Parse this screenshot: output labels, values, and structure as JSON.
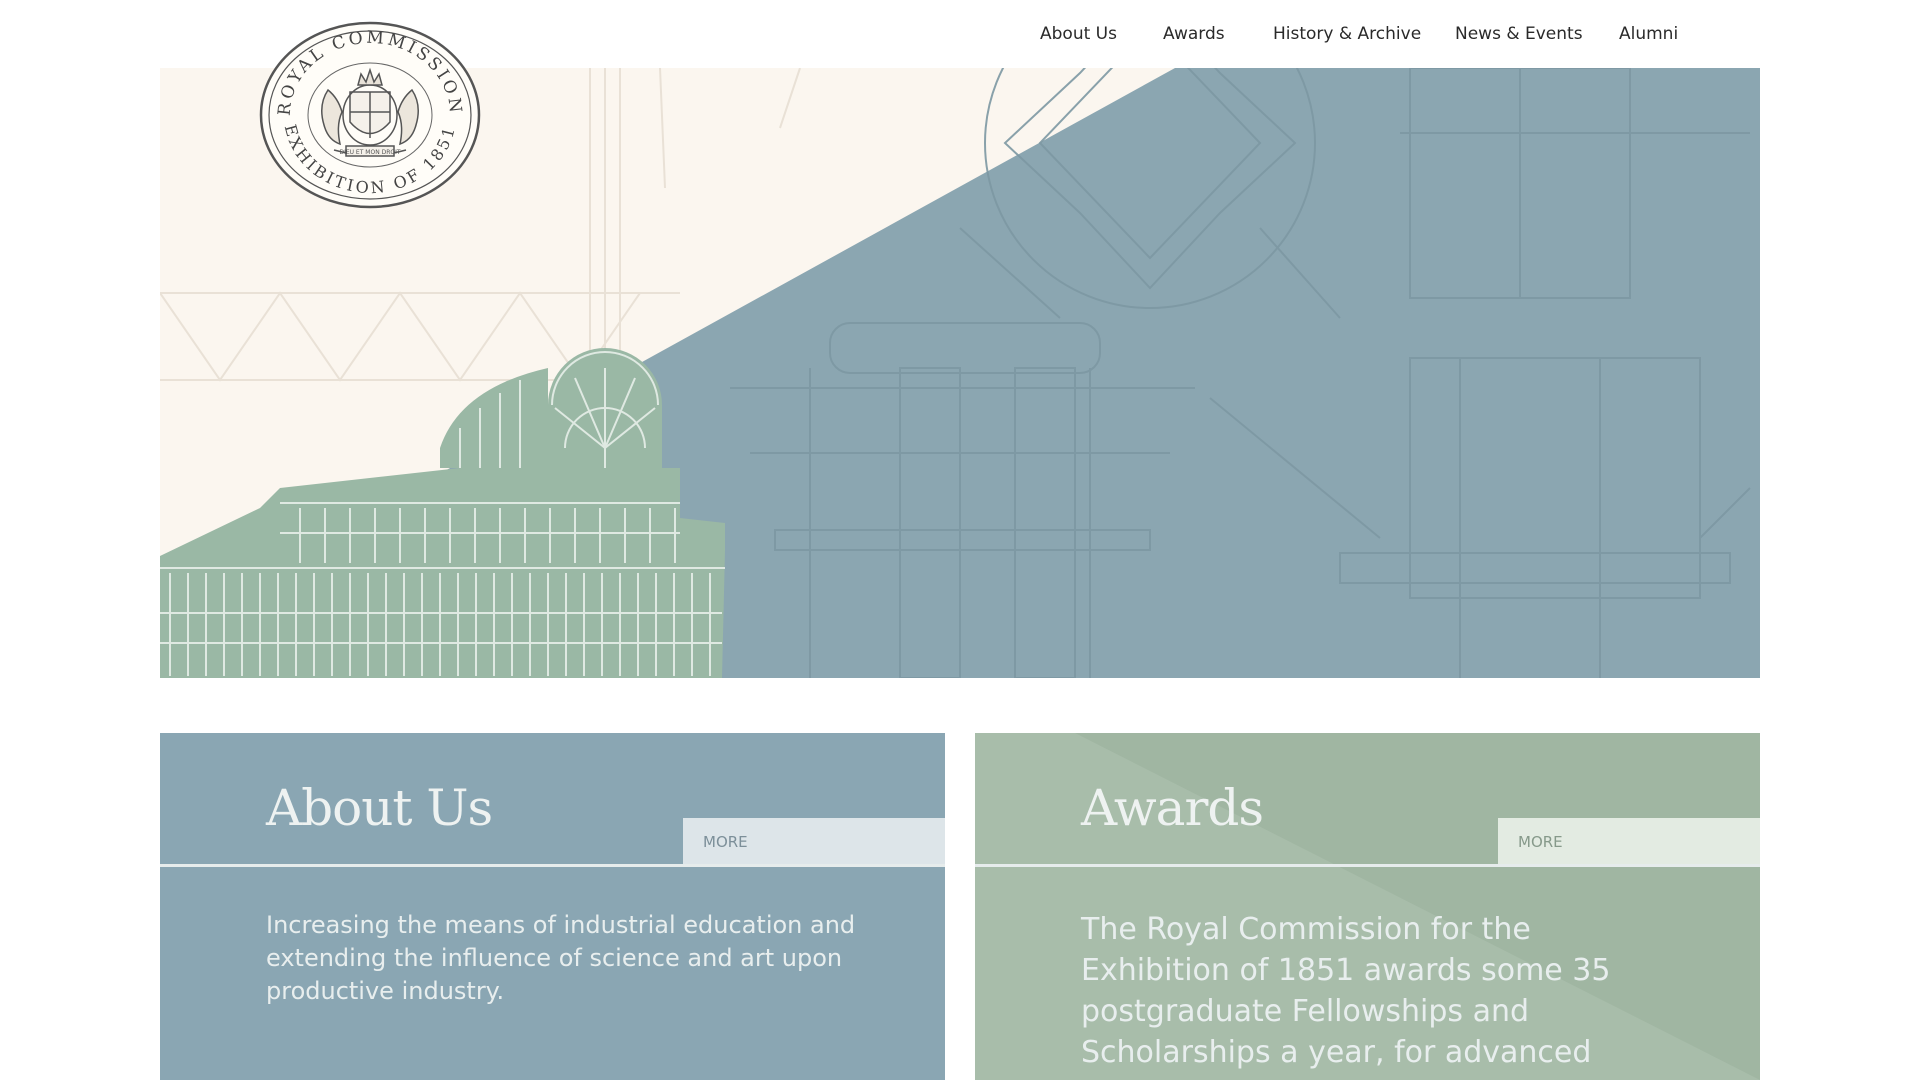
{
  "nav": {
    "items": [
      {
        "label": "About Us"
      },
      {
        "label": "Awards"
      },
      {
        "label": "History & Archive"
      },
      {
        "label": "News & Events"
      },
      {
        "label": "Alumni"
      }
    ]
  },
  "logo": {
    "top_text": "ROYAL COMMISSION",
    "bottom_text": "EXHIBITION OF 1851",
    "motto": "DIEU ET MON DROIT"
  },
  "cards": {
    "about": {
      "title": "About Us",
      "more_label": "MORE",
      "text": "Increasing the means of industrial education and extending the influence of science and art upon productive industry."
    },
    "awards": {
      "title": "Awards",
      "more_label": "MORE",
      "text": "The Royal Commission for the Exhibition of 1851 awards some 35 postgraduate Fellowships and Scholarships a year, for advanced study and research in"
    }
  },
  "colors": {
    "hero_blue": "#8ba6b1",
    "hero_cream": "#fbf6ef",
    "palace_green": "#9ab8a5",
    "card_blue": "#8aa6b3",
    "card_green": "#a7bda9"
  }
}
